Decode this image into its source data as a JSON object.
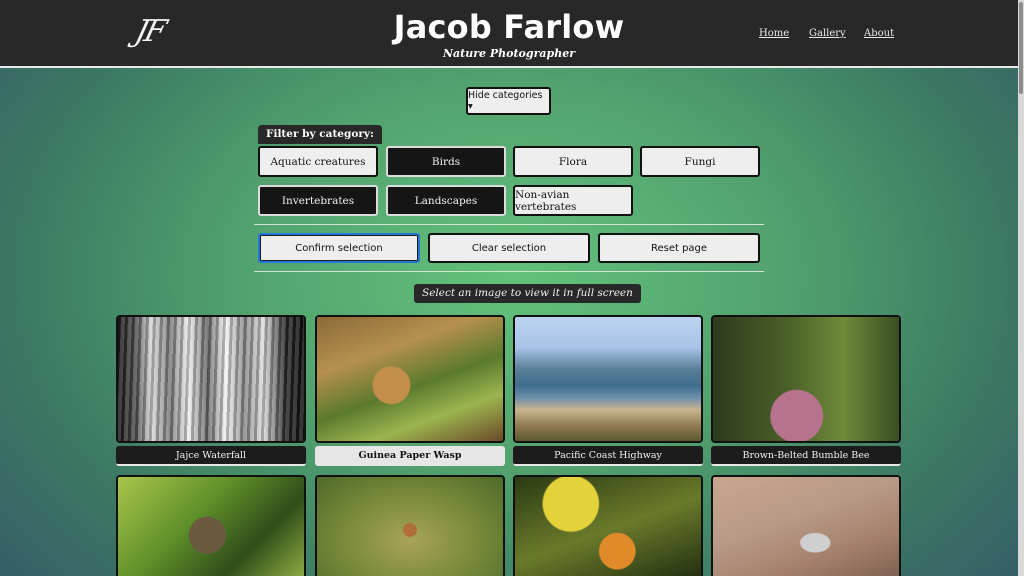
{
  "header": {
    "logo": "JF",
    "title": "Jacob Farlow",
    "subtitle": "Nature Photographer",
    "nav": [
      "Home",
      "Gallery",
      "About"
    ]
  },
  "toggle_label": "Hide categories ▾",
  "filter": {
    "label": "Filter by category:",
    "categories": [
      {
        "label": "Aquatic creatures",
        "selected": false
      },
      {
        "label": "Birds",
        "selected": true
      },
      {
        "label": "Flora",
        "selected": false
      },
      {
        "label": "Fungi",
        "selected": false
      },
      {
        "label": "Invertebrates",
        "selected": true
      },
      {
        "label": "Landscapes",
        "selected": true
      },
      {
        "label": "Non-avian vertebrates",
        "selected": false
      }
    ]
  },
  "actions": [
    "Confirm selection",
    "Clear selection",
    "Reset page"
  ],
  "hint": "Select an image to view it in full screen",
  "gallery": [
    {
      "caption": "Jajce Waterfall",
      "selected": false
    },
    {
      "caption": "Guinea Paper Wasp",
      "selected": true
    },
    {
      "caption": "Pacific Coast Highway",
      "selected": false
    },
    {
      "caption": "Brown-Belted Bumble Bee",
      "selected": false
    }
  ]
}
